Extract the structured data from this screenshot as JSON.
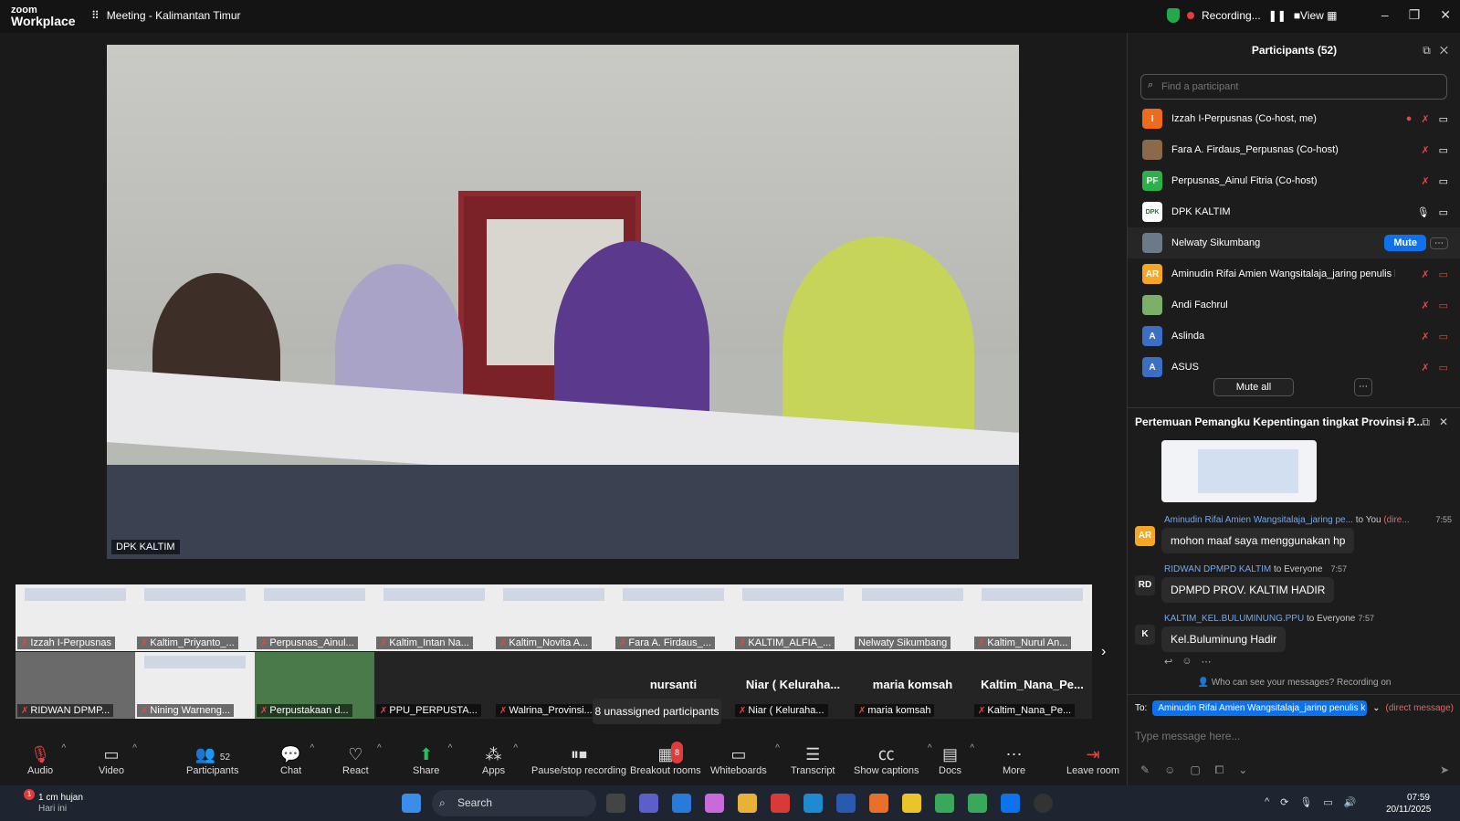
{
  "titlebar": {
    "logo_line1": "zoom",
    "logo_line2": "Workplace",
    "meeting_title": "Meeting - Kalimantan Timur",
    "recording": "Recording...",
    "view": "View"
  },
  "main_video": {
    "label": "DPK KALTIM"
  },
  "gallery": {
    "row1": [
      "Izzah I-Perpusnas",
      "Kaltim_Priyanto_...",
      "Perpusnas_Ainul...",
      "Kaltim_Intan Na...",
      "Kaltim_Novita A...",
      "Fara A. Firdaus_...",
      "KALTIM_ALFIA_...",
      "Nelwaty Sikumbang",
      "Kaltim_Nurul An..."
    ],
    "row2": [
      "RIDWAN DPMP...",
      "Nining Warneng...",
      "Perpustakaan d...",
      "PPU_PERPUSTA...",
      "Walrina_Provinsi...",
      "Niar ( Keluraha...",
      "maria komsah",
      "Kaltim_Nana_Pe..."
    ],
    "big_names": [
      "nursanti",
      "Niar ( Keluraha...",
      "maria komsah",
      "Kaltim_Nana_Pe..."
    ],
    "unassigned": "8 unassigned participants"
  },
  "toolbar": {
    "audio": "Audio",
    "video": "Video",
    "participants": "Participants",
    "participants_count": "52",
    "chat": "Chat",
    "react": "React",
    "share": "Share",
    "apps": "Apps",
    "pause_stop": "Pause/stop recording",
    "breakout": "Breakout rooms",
    "breakout_badge": "8",
    "whiteboards": "Whiteboards",
    "transcript": "Transcript",
    "captions": "Show captions",
    "docs": "Docs",
    "more": "More",
    "leave": "Leave room"
  },
  "participants_panel": {
    "title": "Participants (52)",
    "search_placeholder": "Find a participant",
    "rows": [
      {
        "initials": "I",
        "color": "#f06a1d",
        "name": "Izzah I-Perpusnas (Co-host, me)"
      },
      {
        "initials": "",
        "color": "#8a6a4a",
        "name": "Fara A. Firdaus_Perpusnas (Co-host)"
      },
      {
        "initials": "PF",
        "color": "#2bb04a",
        "name": "Perpusnas_Ainul Fitria (Co-host)"
      },
      {
        "initials": "DPK",
        "color": "#ffffff",
        "name": "DPK KALTIM"
      },
      {
        "initials": "",
        "color": "#6b7a88",
        "name": "Nelwaty Sikumbang"
      },
      {
        "initials": "AR",
        "color": "#f5a623",
        "name": "Aminudin Rifai Amien Wangsitalaja_jaring penulis k"
      },
      {
        "initials": "",
        "color": "#7ab06a",
        "name": "Andi Fachrul"
      },
      {
        "initials": "A",
        "color": "#3a6fc4",
        "name": "Aslinda"
      },
      {
        "initials": "A",
        "color": "#3a6fc4",
        "name": "ASUS"
      }
    ],
    "mute_button": "Mute",
    "mute_all": "Mute all"
  },
  "chat": {
    "title": "Pertemuan Pemangku Kepentingan tingkat Provinsi P...",
    "messages": [
      {
        "from": "Aminudin Rifai Amien Wangsitalaja_jaring pe...",
        "to": "to You",
        "dm": "(dire...",
        "time": "7:55",
        "initials": "AR",
        "avatar_color": "#f5a623",
        "text": "mohon maaf saya menggunakan hp"
      },
      {
        "from": "RIDWAN DPMPD KALTIM",
        "to": "to Everyone",
        "dm": "",
        "time": "7:57",
        "initials": "RD",
        "avatar_color": "#2a2a2a",
        "text": "DPMPD PROV. KALTIM HADIR"
      },
      {
        "from": "KALTIM_KEL.BULUMINUNG.PPU",
        "to": "to Everyone",
        "dm": "",
        "time": "7:57",
        "initials": "K",
        "avatar_color": "#2a2a2a",
        "text": "Kel.Buluminung Hadir"
      }
    ],
    "who_can_see": "Who can see your messages? Recording on",
    "to_label": "To:",
    "to_recipient": "Aminudin Rifai Amien Wangsitalaja_jaring penulis k",
    "direct": "(direct message)",
    "input_placeholder": "Type message here..."
  },
  "taskbar": {
    "weather_temp": "1 cm hujan",
    "weather_day": "Hari ini",
    "weather_badge": "1",
    "search": "Search",
    "time": "07:59",
    "date": "20/11/2025"
  }
}
